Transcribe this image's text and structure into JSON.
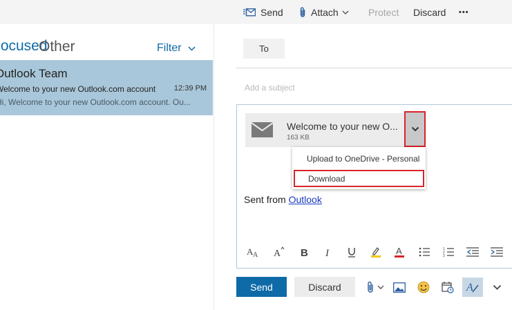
{
  "toolbar": {
    "send_label": "Send",
    "attach_label": "Attach",
    "protect_label": "Protect",
    "discard_label": "Discard",
    "more_label": "•••"
  },
  "inbox": {
    "tab_focused": "Focused",
    "tab_other": "Other",
    "filter_label": "Filter",
    "message": {
      "sender": "Outlook Team",
      "subject": "Welcome to your new Outlook.com account",
      "time": "12:39 PM",
      "preview": "Hi, Welcome to your new Outlook.com account. Ou..."
    }
  },
  "compose": {
    "to_label": "To",
    "subject_placeholder": "Add a subject",
    "attachment": {
      "name": "Welcome to your new O...",
      "size": "163 KB"
    },
    "attachment_menu": [
      "Upload to OneDrive - Personal",
      "Download"
    ],
    "signature_prefix": "Sent from ",
    "signature_link": "Outlook",
    "send_button": "Send",
    "discard_button": "Discard"
  },
  "colors": {
    "accent": "#0f6aa8",
    "selected_row": "#a9c7da",
    "highlight_border": "#d9232b"
  }
}
